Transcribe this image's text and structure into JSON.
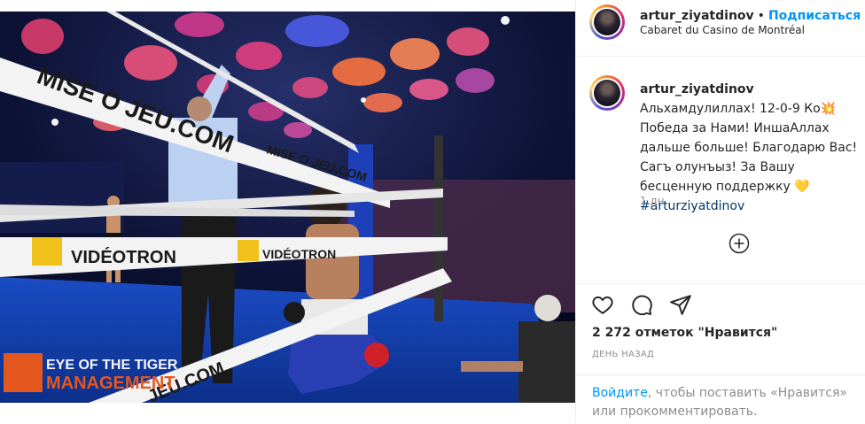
{
  "post": {
    "username": "artur_ziyatdinov",
    "separator": "•",
    "follow_label": "Подписаться",
    "location": "Cabaret du Casino de Montréal"
  },
  "photo": {
    "ring_text_1": "MISE O JEU.COM",
    "ring_text_2": "VIDÉOTRON",
    "ring_text_3": "VIDÉOTRON",
    "ring_text_4": "MISE O JEU.COM",
    "ring_text_5": "JEU.COM",
    "logo_line_1": "EYE OF THE TIGER",
    "logo_line_2": "MANAGEMENT"
  },
  "caption": {
    "username": "artur_ziyatdinov",
    "text": " Альхамдулиллах! 12-0-9 Ко💥 Победа за Нами! ИншаАллах дальше больше! Благодарю Вас! Сагъ олунъыз! За Вашу бесценную поддержку 💛",
    "hashtag": "#arturziyatdinov",
    "time": "1 дн."
  },
  "icons": {
    "like": "heart-icon",
    "comment": "comment-bubble-icon",
    "share": "paper-plane-icon",
    "load_more": "plus-circle-icon"
  },
  "likes_text": "2 272 отметок \"Нравится\"",
  "date_text": "ДЕНЬ НАЗАД",
  "login_prompt": {
    "link": "Войдите",
    "text": ", чтобы поставить «Нравится» или прокомментировать."
  }
}
